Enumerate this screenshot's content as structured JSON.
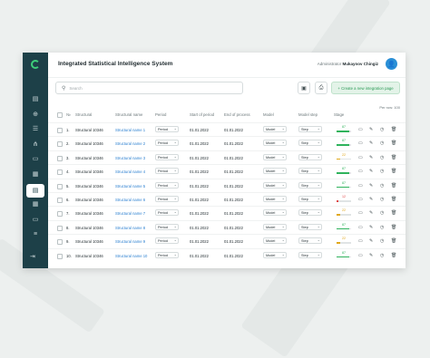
{
  "app": {
    "title": "Integrated Statistical Intelligence System"
  },
  "user": {
    "role": "Administrator",
    "name": "Mukaynov Chingiz",
    "avatar_icon": "user-icon"
  },
  "search": {
    "placeholder": "Search"
  },
  "toolbar": {
    "create_label": "+ Create a new integration page",
    "export_icon": "export-icon",
    "print_icon": "print-icon"
  },
  "table": {
    "per_page": "Per row: 100",
    "headers": [
      "№",
      "Structural",
      "Structural name",
      "Period",
      "Start of period",
      "End of process",
      "Model",
      "Model step",
      "Stage"
    ],
    "rows": [
      {
        "n": "1.",
        "code": "Structural 10346",
        "name": "Structural name 1",
        "period": "Period",
        "start": "01.01.2022",
        "end": "01.01.2022",
        "model": "Model",
        "step": "Step",
        "stage": "87",
        "color": "#2fb35c",
        "fill": 0.87
      },
      {
        "n": "2.",
        "code": "Structural 10346",
        "name": "Structural name 2",
        "period": "Period",
        "start": "01.01.2022",
        "end": "01.01.2022",
        "model": "Model",
        "step": "Step",
        "stage": "87",
        "color": "#2fb35c",
        "fill": 0.87
      },
      {
        "n": "3.",
        "code": "Structural 10346",
        "name": "Structural name 3",
        "period": "Period",
        "start": "01.01.2022",
        "end": "01.01.2022",
        "model": "Model",
        "step": "Step",
        "stage": "22",
        "color": "#e0a81b",
        "fill": 0.22
      },
      {
        "n": "4.",
        "code": "Structural 10346",
        "name": "Structural name 4",
        "period": "Period",
        "start": "01.01.2022",
        "end": "01.01.2022",
        "model": "Model",
        "step": "Step",
        "stage": "87",
        "color": "#2fb35c",
        "fill": 0.87
      },
      {
        "n": "5.",
        "code": "Structural 10346",
        "name": "Structural name 5",
        "period": "Period",
        "start": "01.01.2022",
        "end": "01.01.2022",
        "model": "Model",
        "step": "Step",
        "stage": "87",
        "color": "#2fb35c",
        "fill": 0.87
      },
      {
        "n": "6.",
        "code": "Structural 10346",
        "name": "Structural name 6",
        "period": "Period",
        "start": "01.01.2022",
        "end": "01.01.2022",
        "model": "Model",
        "step": "Step",
        "stage": "12",
        "color": "#e04848",
        "fill": 0.12
      },
      {
        "n": "7.",
        "code": "Structural 10346",
        "name": "Structural name 7",
        "period": "Period",
        "start": "01.01.2022",
        "end": "01.01.2022",
        "model": "Model",
        "step": "Step",
        "stage": "22",
        "color": "#e0a81b",
        "fill": 0.22
      },
      {
        "n": "8.",
        "code": "Structural 10346",
        "name": "Structural name 8",
        "period": "Period",
        "start": "01.01.2022",
        "end": "01.01.2022",
        "model": "Model",
        "step": "Step",
        "stage": "87",
        "color": "#2fb35c",
        "fill": 0.87
      },
      {
        "n": "9.",
        "code": "Structural 10346",
        "name": "Structural name 9",
        "period": "Period",
        "start": "01.01.2022",
        "end": "01.01.2022",
        "model": "Model",
        "step": "Step",
        "stage": "22",
        "color": "#e0a81b",
        "fill": 0.22
      },
      {
        "n": "10.",
        "code": "Structural 10346",
        "name": "Structural name 10",
        "period": "Period",
        "start": "01.01.2022",
        "end": "01.01.2022",
        "model": "Model",
        "step": "Step",
        "stage": "87",
        "color": "#2fb35c",
        "fill": 0.87
      }
    ],
    "row_actions": [
      "view-icon",
      "edit-icon",
      "history-icon",
      "delete-icon"
    ]
  },
  "sidebar": {
    "items": [
      "document-icon",
      "globe-icon",
      "list-icon",
      "hierarchy-icon",
      "folder-icon",
      "calendar-icon",
      "report-icon",
      "grid-icon",
      "monitor-icon",
      "menu-icon"
    ],
    "active_index": 6,
    "logout_icon": "logout-icon"
  },
  "colors": {
    "sidebar": "#1d4048",
    "accent": "#3ecf7a",
    "link": "#2a7fd0"
  }
}
